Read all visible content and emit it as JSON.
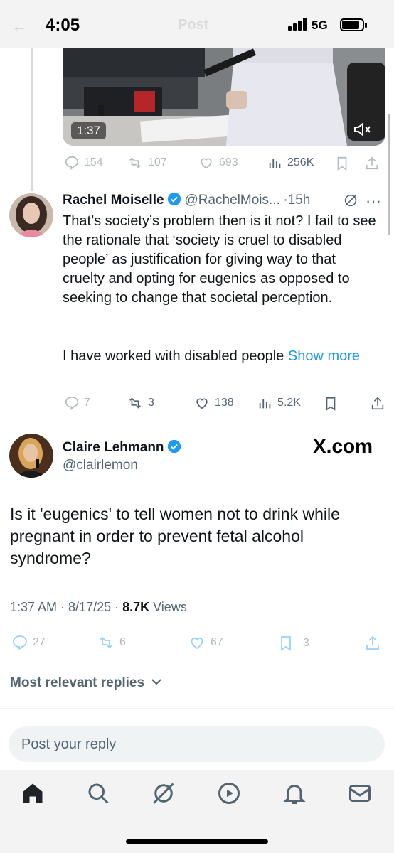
{
  "status_bar": {
    "time": "4:05",
    "network": "5G",
    "ghost_title": "Post"
  },
  "video_tweet": {
    "duration": "1:37",
    "actions": {
      "replies": "154",
      "reposts": "107",
      "likes": "693",
      "views": "256K"
    }
  },
  "reply_tweet": {
    "name": "Rachel Moiselle",
    "handle": "@RachelMois...",
    "time": "15h",
    "text": "That’s society’s problem then is it not? I fail to see the rationale that ‘society is cruel to disabled people’ as justification for giving way to that cruelty and opting for eugenics as opposed to seeking to change that societal perception.",
    "text2": "I have worked with disabled people ",
    "show_more": "Show more",
    "actions": {
      "replies": "7",
      "reposts": "3",
      "likes": "138",
      "views": "5.2K"
    }
  },
  "main_tweet": {
    "name": "Claire Lehmann",
    "handle": "@clairlemon",
    "watermark": "X.com",
    "text": "Is it 'eugenics' to tell women not to drink while pregnant in order to prevent fetal alcohol syndrome?",
    "timestamp": "1:37 AM · 8/17/25 · ",
    "views_count": "8.7K",
    "views_label": " Views",
    "actions": {
      "replies": "27",
      "reposts": "6",
      "likes": "67",
      "bookmarks": "3"
    }
  },
  "replies_sort": "Most relevant replies",
  "reply_input": {
    "placeholder": "Post your reply"
  },
  "tabs": [
    "home",
    "search",
    "grok",
    "video",
    "notifications",
    "messages"
  ],
  "colors": {
    "accent": "#1d9bf0",
    "secondary_text": "#536471"
  }
}
